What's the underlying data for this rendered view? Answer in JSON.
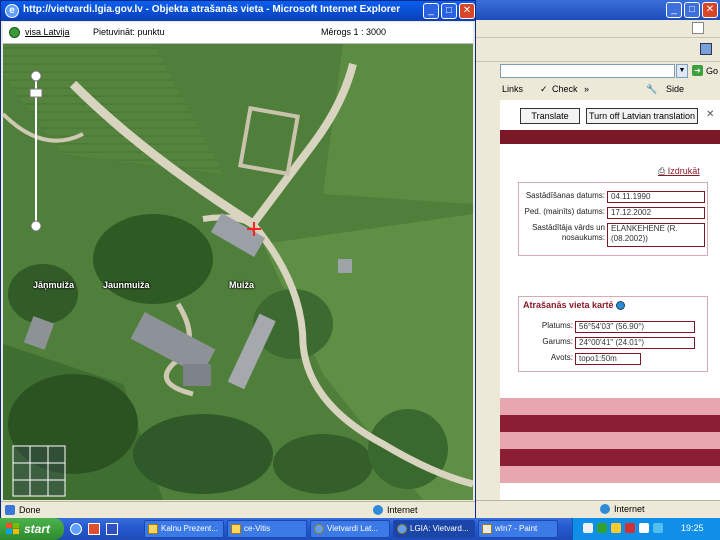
{
  "popup": {
    "title": "http://vietvardi.lgia.gov.lv - Objekta atrašanās vieta - Microsoft Internet Explorer",
    "map_toolbar": {
      "region": "visa Latvija",
      "tool": "Pietuvināt: punktu",
      "scale": "Mērogs 1 : 3000"
    },
    "map": {
      "place_labels": [
        "Jāņmuiža",
        "Jaunmuiža",
        "Muiža"
      ]
    },
    "status": {
      "done": "Done",
      "zone": "Internet"
    }
  },
  "background_window": {
    "toolbar": {
      "links": "Links",
      "go": "Go",
      "check": "Check",
      "side": "Side"
    },
    "buttons": {
      "translate": "Translate",
      "turn_off": "Turn off Latvian translation"
    },
    "print_link": "Izdrukāt",
    "info_panel": {
      "fields": [
        {
          "label": "Sastādīšanas datums:",
          "value": "04.11.1990"
        },
        {
          "label": "Ped. (mainīts) datums:",
          "value": "17.12.2002"
        },
        {
          "label": "Sastādītāja vārds un nosaukums:",
          "value": "ELANKEHENE (R. (08.2002))"
        }
      ]
    },
    "location_panel": {
      "title": "Atrašanās vieta kartē",
      "fields": [
        {
          "label": "Platums:",
          "value": "56°54'03\" (56.90°)"
        },
        {
          "label": "Garums:",
          "value": "24°00'41\" (24.01°)"
        },
        {
          "label": "Avots:",
          "value": "topo1:50m"
        }
      ]
    },
    "status": {
      "zone": "Internet"
    }
  },
  "taskbar": {
    "start": "start",
    "tasks": [
      "Kalnu Prezent...",
      "ce-Vitis",
      "Vietvardi Lat...",
      "LGIA: Vietvard...",
      "wIn7 - Paint"
    ],
    "clock": "19:25"
  },
  "colors": {
    "maroon": "#7a1828",
    "stripe_light": "#e8a6b0",
    "xp_blue": "#245ad0",
    "map_marker": "#ff2020"
  }
}
